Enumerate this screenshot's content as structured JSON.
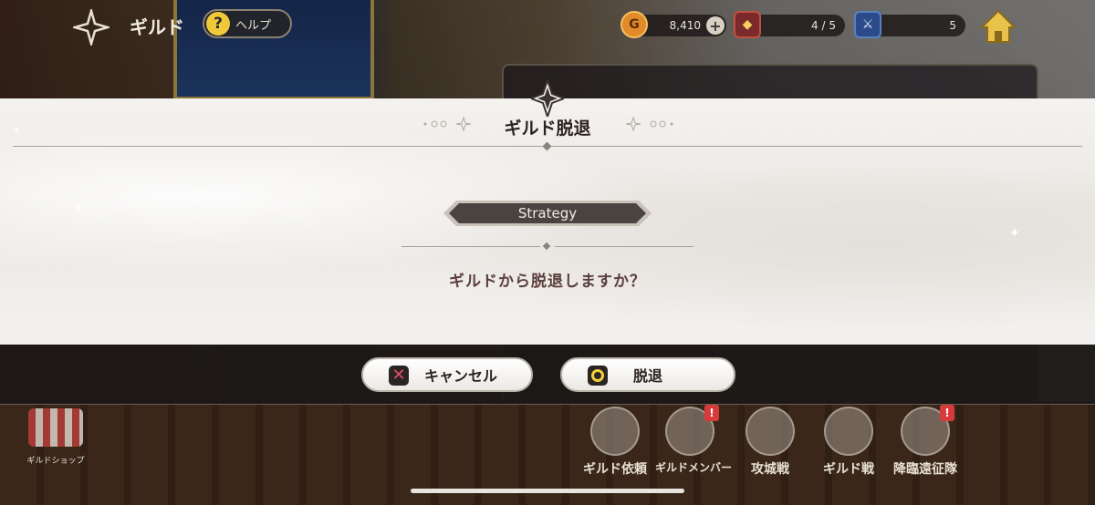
{
  "header": {
    "title": "ギルド",
    "help_label": "ヘルプ",
    "help_icon_glyph": "?"
  },
  "resources": {
    "gold_icon_glyph": "G",
    "gold_value": "8,410",
    "gold_plus": "+",
    "members_value": "4 / 5",
    "battles_value": "5"
  },
  "dialog": {
    "title": "ギルド脱退",
    "guild_name": "Strategy",
    "question": "ギルドから脱退しますか？"
  },
  "buttons": {
    "cancel_label": "キャンセル",
    "confirm_label": "脱退"
  },
  "menu": {
    "shop_label": "ギルドショップ",
    "items": [
      {
        "label": "ギルド依頼",
        "badge": ""
      },
      {
        "label": "ギルドメンバー",
        "badge": "!"
      },
      {
        "label": "攻城戦",
        "badge": ""
      },
      {
        "label": "ギルド戦",
        "badge": ""
      },
      {
        "label": "降臨遠征隊",
        "badge": "!"
      }
    ]
  },
  "colors": {
    "dialog_bg": "#f0eeeb",
    "accent_red": "#e0506a",
    "accent_yellow": "#f0d23a"
  }
}
